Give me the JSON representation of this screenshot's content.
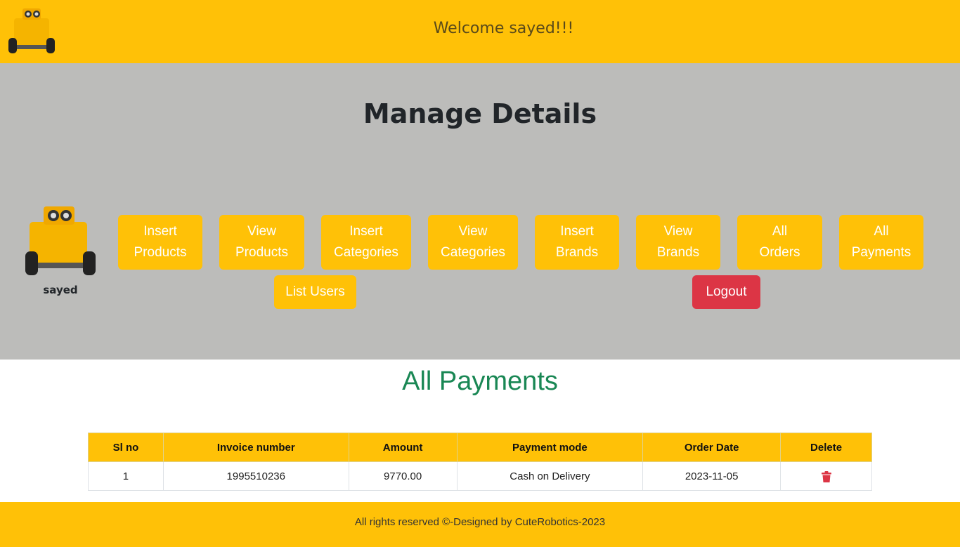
{
  "header": {
    "welcome": "Welcome sayed!!!",
    "logo_icon": "robot-logo-icon"
  },
  "manage": {
    "title": "Manage Details",
    "user": {
      "name": "sayed",
      "avatar_icon": "robot-avatar-icon"
    },
    "buttons": [
      {
        "line1": "Insert",
        "line2": "Products"
      },
      {
        "line1": "View",
        "line2": "Products"
      },
      {
        "line1": "Insert",
        "line2": "Categories"
      },
      {
        "line1": "View",
        "line2": "Categories"
      },
      {
        "line1": "Insert",
        "line2": "Brands"
      },
      {
        "line1": "View",
        "line2": "Brands"
      },
      {
        "line1": "All",
        "line2": "Orders"
      },
      {
        "line1": "All",
        "line2": "Payments"
      }
    ],
    "list_users": "List Users",
    "logout": "Logout"
  },
  "payments": {
    "title": "All Payments",
    "columns": [
      "Sl no",
      "Invoice number",
      "Amount",
      "Payment mode",
      "Order Date",
      "Delete"
    ],
    "rows": [
      {
        "sl": "1",
        "invoice": "1995510236",
        "amount": "9770.00",
        "mode": "Cash on Delivery",
        "date": "2023-11-05",
        "delete_icon": "trash-icon"
      }
    ]
  },
  "footer": {
    "text": "All rights reserved ©-Designed by CuteRobotics-2023"
  },
  "colors": {
    "accent": "#ffc107",
    "section_bg": "#bcbcba",
    "success": "#198754",
    "danger": "#dc3545"
  }
}
